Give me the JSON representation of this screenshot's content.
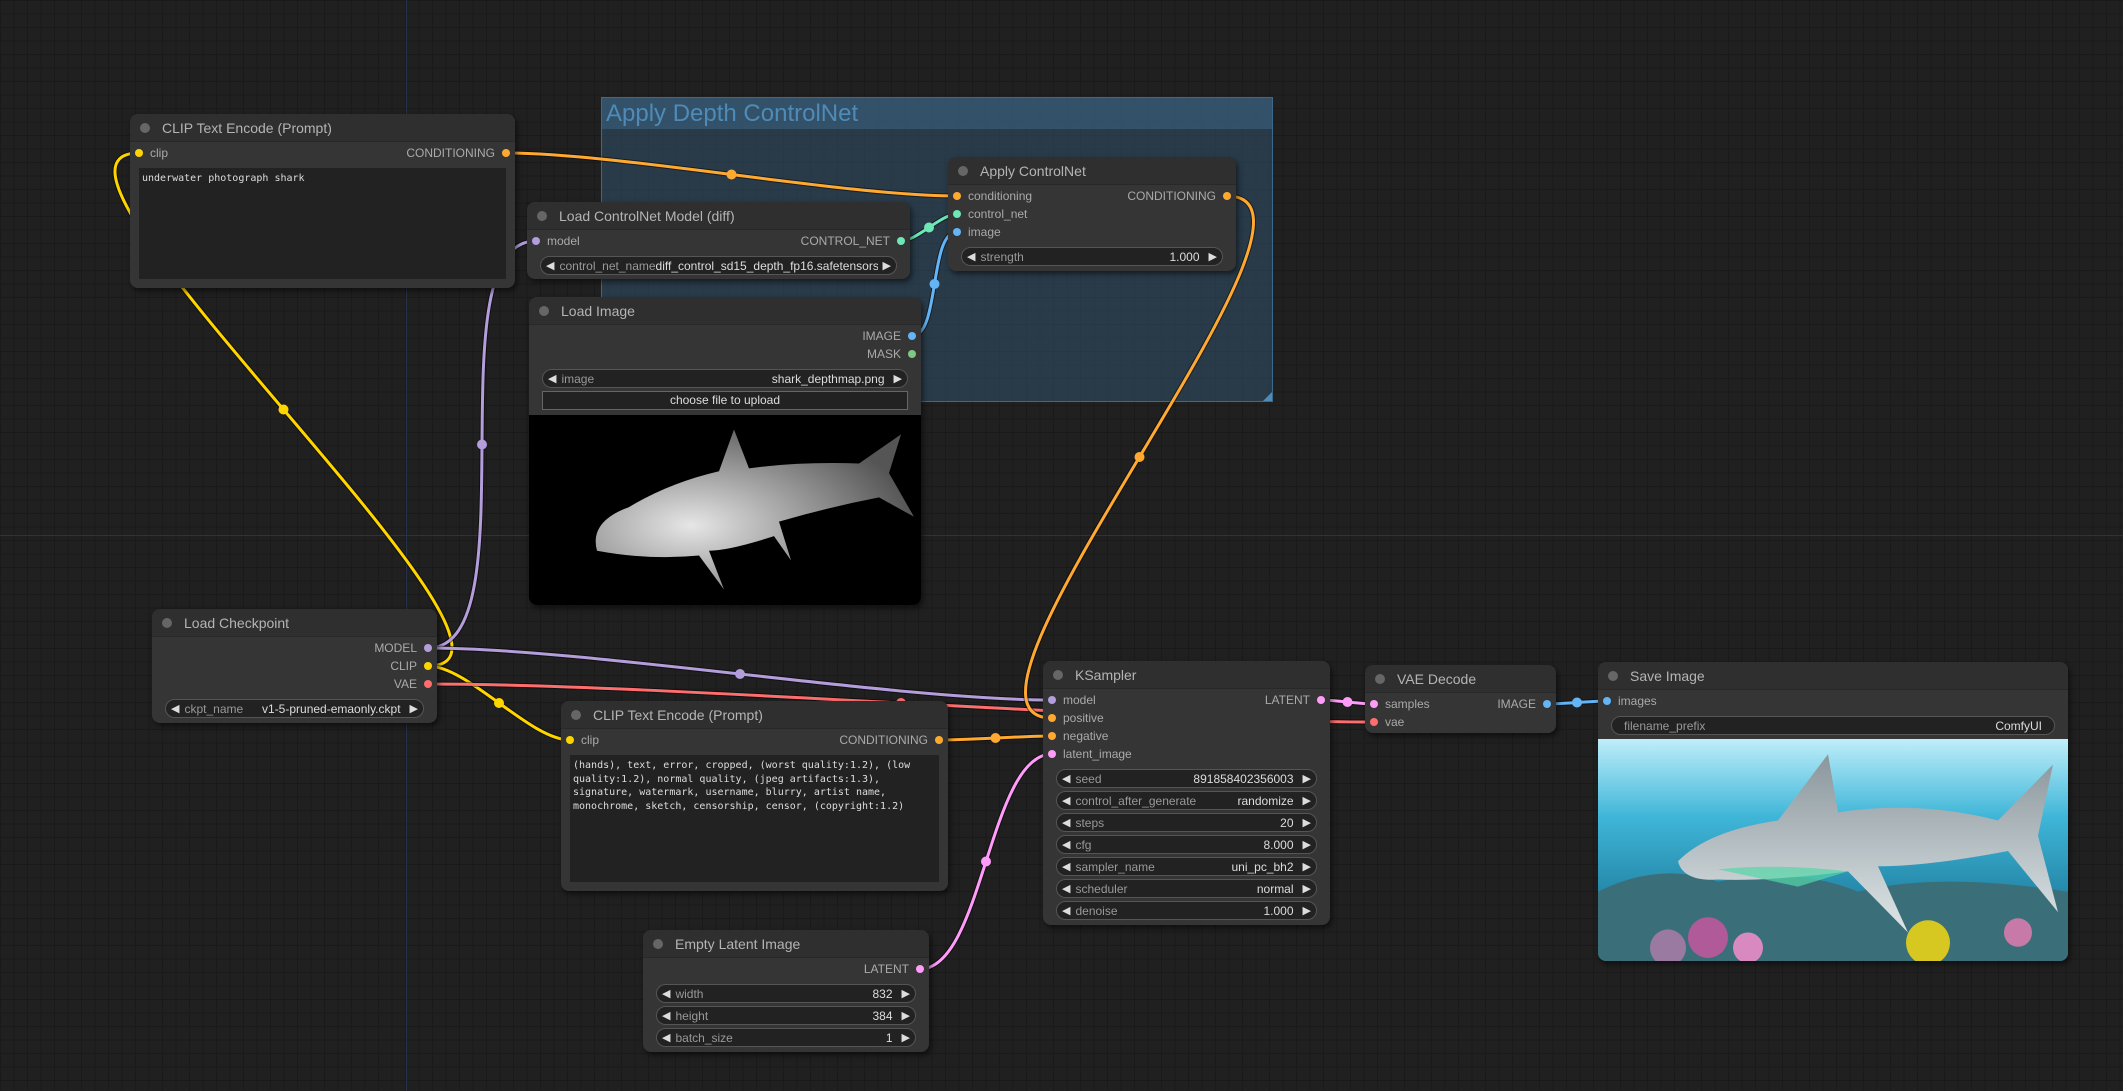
{
  "group": {
    "title": "Apply Depth ControlNet"
  },
  "colors": {
    "CLIP": "#FFD500",
    "CONDITIONING": "#FFA931",
    "CONTROL_NET": "#6EE7B7",
    "IMAGE": "#64B5F6",
    "MASK": "#81C784",
    "MODEL": "#B39DDB",
    "VAE": "#FF6E6E",
    "LATENT": "#FF9CF9"
  },
  "nodes": [
    {
      "id": "clip_pos",
      "title": "CLIP Text Encode (Prompt)",
      "inputs": [
        {
          "name": "clip",
          "type": "CLIP"
        }
      ],
      "outputs": [
        {
          "name": "CONDITIONING",
          "type": "CONDITIONING"
        }
      ],
      "widgets": [],
      "text": "underwater photograph shark"
    },
    {
      "id": "cn_loader",
      "title": "Load ControlNet Model (diff)",
      "inputs": [
        {
          "name": "model",
          "type": "MODEL"
        }
      ],
      "outputs": [
        {
          "name": "CONTROL_NET",
          "type": "CONTROL_NET"
        }
      ],
      "widgets": [
        {
          "label": "control_net_name",
          "value": "diff_control_sd15_depth_fp16.safetensors"
        }
      ]
    },
    {
      "id": "load_image",
      "title": "Load Image",
      "inputs": [],
      "outputs": [
        {
          "name": "IMAGE",
          "type": "IMAGE"
        },
        {
          "name": "MASK",
          "type": "MASK"
        }
      ],
      "widgets": [
        {
          "label": "image",
          "value": "shark_depthmap.png"
        }
      ],
      "button": "choose file to upload",
      "image": "depth"
    },
    {
      "id": "apply_cn",
      "title": "Apply ControlNet",
      "inputs": [
        {
          "name": "conditioning",
          "type": "CONDITIONING"
        },
        {
          "name": "control_net",
          "type": "CONTROL_NET"
        },
        {
          "name": "image",
          "type": "IMAGE"
        }
      ],
      "outputs": [
        {
          "name": "CONDITIONING",
          "type": "CONDITIONING"
        }
      ],
      "widgets": [
        {
          "label": "strength",
          "value": "1.000"
        }
      ]
    },
    {
      "id": "ckpt",
      "title": "Load Checkpoint",
      "inputs": [],
      "outputs": [
        {
          "name": "MODEL",
          "type": "MODEL"
        },
        {
          "name": "CLIP",
          "type": "CLIP"
        },
        {
          "name": "VAE",
          "type": "VAE"
        }
      ],
      "widgets": [
        {
          "label": "ckpt_name",
          "value": "v1-5-pruned-emaonly.ckpt"
        }
      ]
    },
    {
      "id": "clip_neg",
      "title": "CLIP Text Encode (Prompt)",
      "inputs": [
        {
          "name": "clip",
          "type": "CLIP"
        }
      ],
      "outputs": [
        {
          "name": "CONDITIONING",
          "type": "CONDITIONING"
        }
      ],
      "widgets": [],
      "text": "(hands), text, error, cropped, (worst quality:1.2), (low quality:1.2), normal quality, (jpeg artifacts:1.3), signature, watermark, username, blurry, artist name, monochrome, sketch, censorship, censor, (copyright:1.2)"
    },
    {
      "id": "latent",
      "title": "Empty Latent Image",
      "inputs": [],
      "outputs": [
        {
          "name": "LATENT",
          "type": "LATENT"
        }
      ],
      "widgets": [
        {
          "label": "width",
          "value": "832"
        },
        {
          "label": "height",
          "value": "384"
        },
        {
          "label": "batch_size",
          "value": "1"
        }
      ]
    },
    {
      "id": "ksampler",
      "title": "KSampler",
      "inputs": [
        {
          "name": "model",
          "type": "MODEL"
        },
        {
          "name": "positive",
          "type": "CONDITIONING"
        },
        {
          "name": "negative",
          "type": "CONDITIONING"
        },
        {
          "name": "latent_image",
          "type": "LATENT"
        }
      ],
      "outputs": [
        {
          "name": "LATENT",
          "type": "LATENT"
        }
      ],
      "widgets": [
        {
          "label": "seed",
          "value": "891858402356003"
        },
        {
          "label": "control_after_generate",
          "value": "randomize"
        },
        {
          "label": "steps",
          "value": "20"
        },
        {
          "label": "cfg",
          "value": "8.000"
        },
        {
          "label": "sampler_name",
          "value": "uni_pc_bh2"
        },
        {
          "label": "scheduler",
          "value": "normal"
        },
        {
          "label": "denoise",
          "value": "1.000"
        }
      ]
    },
    {
      "id": "vae_decode",
      "title": "VAE Decode",
      "inputs": [
        {
          "name": "samples",
          "type": "LATENT"
        },
        {
          "name": "vae",
          "type": "VAE"
        }
      ],
      "outputs": [
        {
          "name": "IMAGE",
          "type": "IMAGE"
        }
      ],
      "widgets": []
    },
    {
      "id": "save",
      "title": "Save Image",
      "inputs": [
        {
          "name": "images",
          "type": "IMAGE"
        }
      ],
      "outputs": [],
      "widgets": [
        {
          "label": "filename_prefix",
          "value": "ComfyUI",
          "noarrows": true
        }
      ],
      "image": "output"
    }
  ],
  "links": [
    {
      "from": [
        "ckpt",
        1
      ],
      "to": [
        "clip_pos",
        0
      ],
      "type": "CLIP"
    },
    {
      "from": [
        "ckpt",
        1
      ],
      "to": [
        "clip_neg",
        0
      ],
      "type": "CLIP"
    },
    {
      "from": [
        "ckpt",
        0
      ],
      "to": [
        "cn_loader",
        0
      ],
      "type": "MODEL"
    },
    {
      "from": [
        "ckpt",
        0
      ],
      "to": [
        "ksampler",
        0
      ],
      "type": "MODEL"
    },
    {
      "from": [
        "ckpt",
        2
      ],
      "to": [
        "vae_decode",
        1
      ],
      "type": "VAE"
    },
    {
      "from": [
        "clip_pos",
        0
      ],
      "to": [
        "apply_cn",
        0
      ],
      "type": "CONDITIONING"
    },
    {
      "from": [
        "cn_loader",
        0
      ],
      "to": [
        "apply_cn",
        1
      ],
      "type": "CONTROL_NET"
    },
    {
      "from": [
        "load_image",
        0
      ],
      "to": [
        "apply_cn",
        2
      ],
      "type": "IMAGE"
    },
    {
      "from": [
        "apply_cn",
        0
      ],
      "to": [
        "ksampler",
        1
      ],
      "type": "CONDITIONING"
    },
    {
      "from": [
        "clip_neg",
        0
      ],
      "to": [
        "ksampler",
        2
      ],
      "type": "CONDITIONING"
    },
    {
      "from": [
        "latent",
        0
      ],
      "to": [
        "ksampler",
        3
      ],
      "type": "LATENT"
    },
    {
      "from": [
        "ksampler",
        0
      ],
      "to": [
        "vae_decode",
        0
      ],
      "type": "LATENT"
    },
    {
      "from": [
        "vae_decode",
        0
      ],
      "to": [
        "save",
        0
      ],
      "type": "IMAGE"
    }
  ]
}
